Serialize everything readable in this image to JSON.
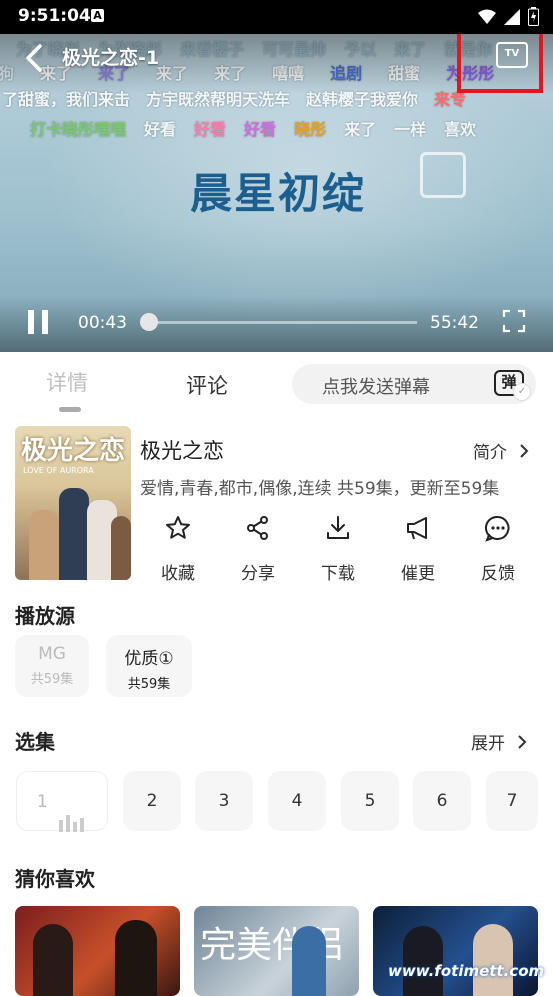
{
  "status_bar": {
    "time": "9:51:04",
    "app_badge": "A"
  },
  "player": {
    "title": "极光之恋-1",
    "tv_label": "TV",
    "overlay_logo_text": "晨星初绽",
    "current_time": "00:43",
    "total_time": "55:42",
    "progress_fraction": 0.013,
    "danmaku_rows": [
      [
        {
          "text": "为了晓彤",
          "color": "#9ec1d1"
        },
        {
          "text": "为张晓彤",
          "color": "#9ec1d1"
        },
        {
          "text": "来看樱子",
          "color": "#9ec1d1"
        },
        {
          "text": "可可最帅",
          "color": "#9ec1d1"
        },
        {
          "text": "予以",
          "color": "#9ec1d1"
        },
        {
          "text": "来了",
          "color": "#9ec1d1"
        },
        {
          "text": "就是你",
          "color": "#9ec1d1"
        }
      ],
      [
        {
          "text": "狗",
          "color": "#d7e6ee"
        },
        {
          "text": "来了",
          "color": "#f2f6f8"
        },
        {
          "text": "来了",
          "color": "#8a7fd9"
        },
        {
          "text": "来了",
          "color": "#f2f6f8"
        },
        {
          "text": "来了",
          "color": "#f2f6f8"
        },
        {
          "text": "嘻嘻",
          "color": "#f2f6f8"
        },
        {
          "text": "追剧",
          "color": "#4a6fd0"
        },
        {
          "text": "甜蜜",
          "color": "#f2f6f8"
        },
        {
          "text": "为彤彤",
          "color": "#8a5fe8"
        }
      ],
      [
        {
          "text": "了甜蜜，我们来击",
          "color": "#f2f6f8"
        },
        {
          "text": "方宇既然帮明天洗车",
          "color": "#f2f6f8"
        },
        {
          "text": "赵韩樱子我爱你",
          "color": "#f2f6f8"
        },
        {
          "text": "来专",
          "color": "#ff6a6a"
        }
      ],
      [
        {
          "text": "打卡晓彤嘿嘿",
          "color": "#7bc96f"
        },
        {
          "text": "好看",
          "color": "#f2f6f8"
        },
        {
          "text": "好看",
          "color": "#ff7aa8"
        },
        {
          "text": "好看",
          "color": "#d06be0"
        },
        {
          "text": "晓彤",
          "color": "#e8a01e"
        },
        {
          "text": "来了",
          "color": "#f2f6f8"
        },
        {
          "text": "一样",
          "color": "#f2f6f8"
        },
        {
          "text": "喜欢",
          "color": "#f2f6f8"
        }
      ]
    ]
  },
  "tabs": {
    "detail": "详情",
    "comment": "评论",
    "danmu_placeholder": "点我发送弹幕",
    "danmu_toggle": "弹"
  },
  "show": {
    "poster_title": "极光之恋",
    "poster_subtitle": "LOVE OF AURORA",
    "title": "极光之恋",
    "intro_label": "简介",
    "tags": "爱情,青春,都市,偶像,连续  共59集，更新至59集"
  },
  "actions": [
    {
      "label": "收藏",
      "icon": "star-icon"
    },
    {
      "label": "分享",
      "icon": "share-icon"
    },
    {
      "label": "下载",
      "icon": "download-icon"
    },
    {
      "label": "催更",
      "icon": "megaphone-icon"
    },
    {
      "label": "反馈",
      "icon": "feedback-icon"
    }
  ],
  "source": {
    "heading": "播放源",
    "items": [
      {
        "name": "MG",
        "count": "共59集",
        "muted": true
      },
      {
        "name": "优质①",
        "count": "共59集",
        "muted": false
      }
    ]
  },
  "episodes": {
    "heading": "选集",
    "expand_label": "展开",
    "items": [
      "1",
      "2",
      "3",
      "4",
      "5",
      "6",
      "7"
    ]
  },
  "recommend": {
    "heading": "猜你喜欢",
    "thumb2_text": "完美伴侣"
  },
  "watermark": "www.fotimett.com"
}
